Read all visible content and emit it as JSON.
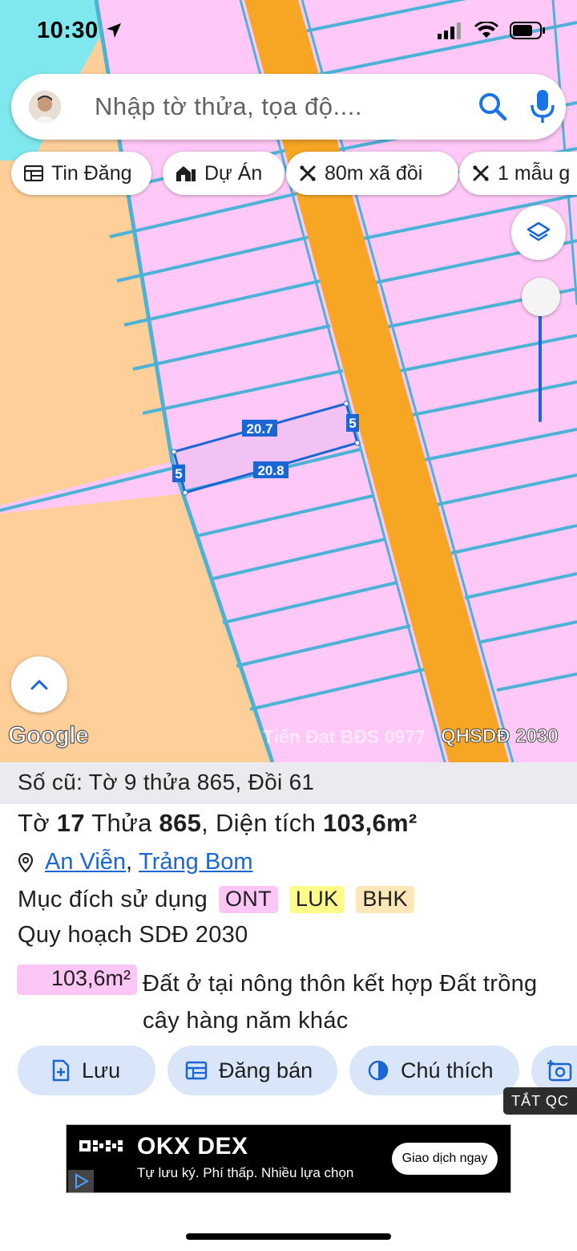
{
  "status_bar": {
    "time": "10:30"
  },
  "search": {
    "placeholder": "Nhập tờ thửa, tọa độ...."
  },
  "chips": [
    {
      "label": "Tin Đăng",
      "icon": "listing-icon"
    },
    {
      "label": "Dự Án",
      "icon": "project-icon"
    },
    {
      "label": "80m xã đồi",
      "icon": "ruler-icon"
    },
    {
      "label": "1 mẫu g",
      "icon": "ruler-icon"
    }
  ],
  "map": {
    "measurements": {
      "top_edge": "20.7",
      "bottom_edge": "20.8",
      "left_edge": "5",
      "right_edge": "5"
    },
    "attribution": "Google",
    "watermark": "Tiến Đạt BĐS 0977",
    "layer_label": "QHSDĐ 2030",
    "colors": {
      "rural_residential": "#ffc8f6",
      "agricultural": "#ffcf9a",
      "road": "#f6a623",
      "parcel_border": "#4db3d6",
      "selection": "#1a66d2",
      "water": "#7fe8ee"
    }
  },
  "parcel": {
    "old_info": "Số cũ: Tờ 9 thửa 865, Đồi 61",
    "sheet_label": "Tờ",
    "sheet": "17",
    "plot_label": "Thửa",
    "plot": "865",
    "area_label": "Diện tích",
    "area": "103,6m²",
    "commune": "An Viễn",
    "district": "Trảng Bom",
    "purpose_label": "Mục đích sử dụng",
    "purposes": [
      {
        "code": "ONT",
        "color": "#fdc6f4"
      },
      {
        "code": "LUK",
        "color": "#fdfc8a"
      },
      {
        "code": "BHK",
        "color": "#fde7b8"
      }
    ],
    "plan_label": "Quy hoạch SDĐ 2030",
    "plan_area": "103,6m²",
    "plan_description": "Đất ở tại nông thôn kết hợp Đất trồng cây hàng năm khác"
  },
  "actions": [
    {
      "label": "Lưu",
      "icon": "add-file-icon"
    },
    {
      "label": "Đăng bán",
      "icon": "listing-icon"
    },
    {
      "label": "Chú thích",
      "icon": "contrast-icon"
    }
  ],
  "ad": {
    "close_label": "TẮT QC",
    "title": "OKX DEX",
    "subtitle": "Tự lưu ký. Phí thấp. Nhiều lựa chọn",
    "cta": "Giao dịch ngay"
  }
}
